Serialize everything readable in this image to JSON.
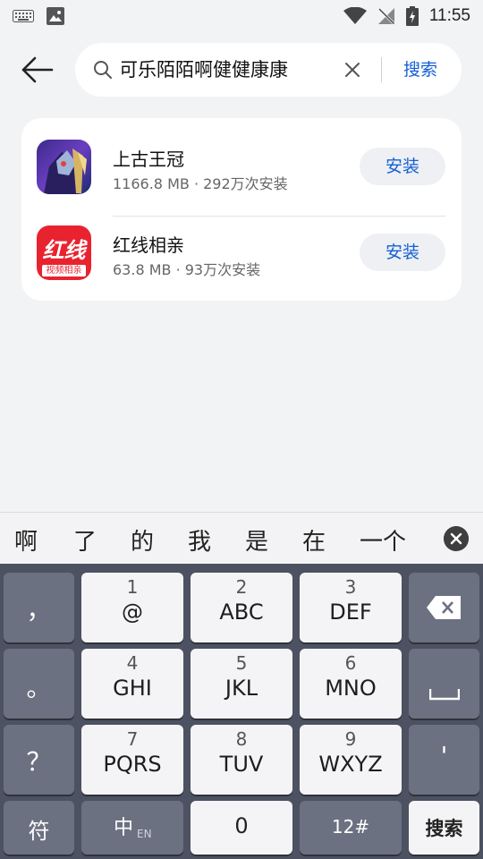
{
  "status_bar": {
    "time": "11:55"
  },
  "search": {
    "query": "可乐陌陌啊健健康康",
    "search_button": "搜索"
  },
  "results": [
    {
      "name": "上古王冠",
      "size": "1166.8 MB",
      "installs": "292万次安装",
      "meta": "1166.8 MB · 292万次安装",
      "action": "安装"
    },
    {
      "name": "红线相亲",
      "size": "63.8 MB",
      "installs": "93万次安装",
      "meta": "63.8 MB · 93万次安装",
      "action": "安装",
      "icon_text": "红线",
      "icon_subtext": "视频相亲"
    }
  ],
  "candidates": [
    "啊",
    "了",
    "的",
    "我",
    "是",
    "在",
    "一个"
  ],
  "keyboard": {
    "row1": {
      "left": "，",
      "keys": [
        {
          "num": "1",
          "letters": "@"
        },
        {
          "num": "2",
          "letters": "ABC"
        },
        {
          "num": "3",
          "letters": "DEF"
        }
      ]
    },
    "row2": {
      "left": "。",
      "keys": [
        {
          "num": "4",
          "letters": "GHI"
        },
        {
          "num": "5",
          "letters": "JKL"
        },
        {
          "num": "6",
          "letters": "MNO"
        }
      ]
    },
    "row3": {
      "left": "？",
      "keys": [
        {
          "num": "7",
          "letters": "PQRS"
        },
        {
          "num": "8",
          "letters": "TUV"
        },
        {
          "num": "9",
          "letters": "WXYZ"
        }
      ],
      "right": "'"
    },
    "row4": {
      "symbols": "符",
      "lang": "中",
      "lang_sub": "EN",
      "zero": "0",
      "num_mode": "12#",
      "enter": "搜索"
    }
  },
  "colors": {
    "accent": "#1560d5",
    "background": "#f1f3f5",
    "keyboard": "#4c5261"
  }
}
